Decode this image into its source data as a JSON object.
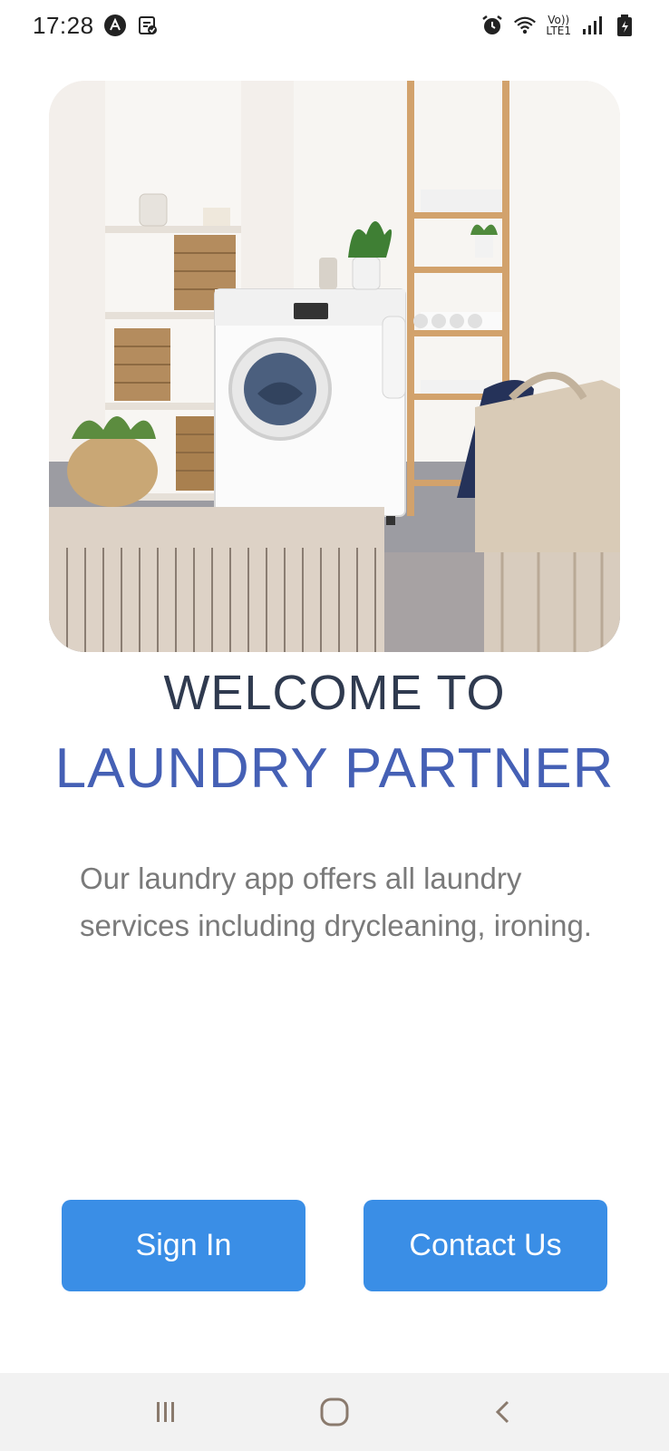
{
  "status_bar": {
    "time": "17:28",
    "icons_left": [
      "app-notification-icon",
      "clipboard-icon"
    ],
    "icons_right": [
      "alarm-icon",
      "wifi-icon",
      "volte-lte-icon",
      "signal-icon",
      "battery-icon"
    ],
    "volte_text_top": "Vo))",
    "volte_text_bottom": "LTE1"
  },
  "hero": {
    "image_description_icon": "laundry-room-image"
  },
  "headline": {
    "welcome": "WELCOME TO",
    "brand": "LAUNDRY PARTNER"
  },
  "description": "Our laundry app offers all laundry services including drycleaning, ironing.",
  "buttons": {
    "sign_in": "Sign In",
    "contact_us": "Contact Us"
  },
  "nav_bar": {
    "items": [
      "recent-apps-icon",
      "home-icon",
      "back-icon"
    ]
  },
  "colors": {
    "brand": "#4560b5",
    "headline": "#2f3a4f",
    "button": "#3a8ee6",
    "description": "#7a7a7a"
  }
}
